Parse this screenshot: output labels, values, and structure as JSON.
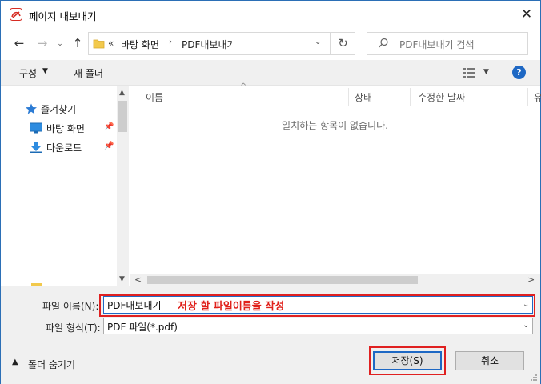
{
  "window": {
    "title": "페이지 내보내기",
    "close_glyph": "✕",
    "app_icon": "pdf-export-icon",
    "accent": "#1e68c4",
    "annotation_color": "#e02020"
  },
  "address": {
    "back_glyph": "←",
    "forward_glyph": "→",
    "dropdown_glyph": "⌄",
    "up_glyph": "↑",
    "more_glyph": "«",
    "breadcrumb": [
      "바탕 화면",
      "PDF내보내기"
    ],
    "separator_glyph": "›",
    "address_dropdown_glyph": "⌄",
    "refresh_glyph": "↻",
    "search_placeholder": "PDF내보내기 검색"
  },
  "toolbar": {
    "organize_label": "구성",
    "organize_caret": "▼",
    "new_folder_label": "새 폴더",
    "view_caret": "▼",
    "help_label": "?"
  },
  "nav_pane": {
    "items": [
      {
        "label": "즐겨찾기",
        "icon": "star-icon"
      },
      {
        "label": "바탕 화면",
        "icon": "desktop-icon",
        "pin": "📌"
      },
      {
        "label": "다운로드",
        "icon": "download-icon",
        "pin": "📌"
      }
    ],
    "scroll_up": "▲",
    "scroll_down": "▼"
  },
  "file_pane": {
    "sort_glyph": "^",
    "columns": [
      "이름",
      "상태",
      "수정한 날짜",
      "유"
    ],
    "empty_message": "일치하는 항목이 없습니다.",
    "scroll_left": "<",
    "scroll_right": ">"
  },
  "form": {
    "filename_label": "파일 이름(N):",
    "filename_value": "PDF내보내기",
    "filename_caret": "⌄",
    "filetype_label": "파일 형식(T):",
    "filetype_value": "PDF 파일(*.pdf)",
    "filetype_caret": "⌄",
    "annotation": "저장 할 파일이름을 작성"
  },
  "footer": {
    "hide_folders_caret": "▲",
    "hide_folders_label": "폴더 숨기기",
    "save_label": "저장(S)",
    "cancel_label": "취소"
  }
}
